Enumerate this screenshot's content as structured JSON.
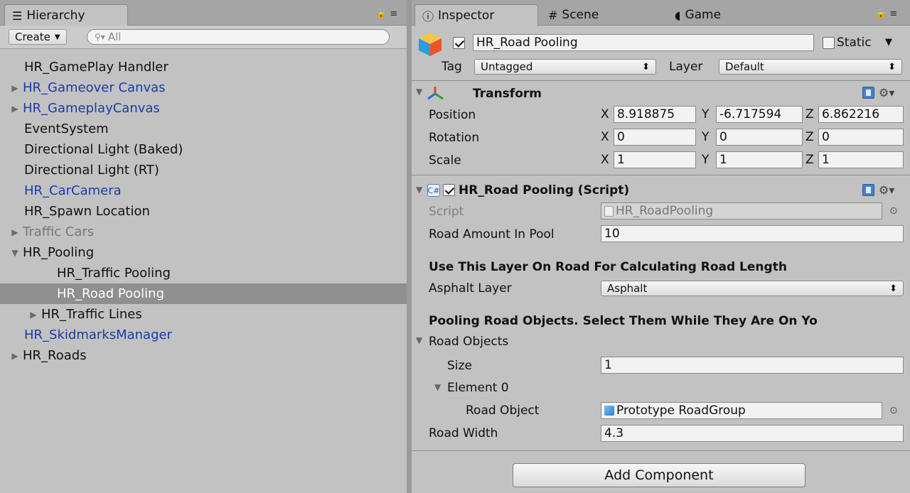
{
  "hierarchy": {
    "tab_label": "Hierarchy",
    "create_label": "Create",
    "search_placeholder": "All",
    "items": [
      {
        "label": "HR_GamePlay Handler",
        "style": "normal",
        "arrow": ""
      },
      {
        "label": "HR_Gameover Canvas",
        "style": "blue",
        "arrow": "▶"
      },
      {
        "label": "HR_GameplayCanvas",
        "style": "blue",
        "arrow": "▶"
      },
      {
        "label": "EventSystem",
        "style": "normal",
        "arrow": ""
      },
      {
        "label": "Directional Light (Baked)",
        "style": "normal",
        "arrow": ""
      },
      {
        "label": "Directional Light (RT)",
        "style": "normal",
        "arrow": ""
      },
      {
        "label": "HR_CarCamera",
        "style": "blue",
        "arrow": ""
      },
      {
        "label": "HR_Spawn Location",
        "style": "normal",
        "arrow": ""
      },
      {
        "label": "Traffic Cars",
        "style": "gray",
        "arrow": "▶"
      },
      {
        "label": "HR_Pooling",
        "style": "normal",
        "arrow": "▼"
      },
      {
        "label": "HR_Traffic Pooling",
        "style": "normal",
        "arrow": ""
      },
      {
        "label": "HR_Road Pooling",
        "style": "selected",
        "arrow": ""
      },
      {
        "label": "HR_Traffic Lines",
        "style": "normal",
        "arrow": "▶"
      },
      {
        "label": "HR_SkidmarksManager",
        "style": "blue",
        "arrow": ""
      },
      {
        "label": "HR_Roads",
        "style": "normal",
        "arrow": "▶"
      }
    ]
  },
  "tabs": {
    "inspector": "Inspector",
    "scene": "Scene",
    "game": "Game"
  },
  "inspector": {
    "object_name": "HR_Road Pooling",
    "static_label": "Static",
    "tag_label": "Tag",
    "tag_value": "Untagged",
    "layer_label": "Layer",
    "layer_value": "Default",
    "transform": {
      "title": "Transform",
      "position_label": "Position",
      "rotation_label": "Rotation",
      "scale_label": "Scale",
      "axis_x": "X",
      "axis_y": "Y",
      "axis_z": "Z",
      "position": [
        "8.918875",
        "-6.717594",
        "6.862216"
      ],
      "rotation": [
        "0",
        "0",
        "0"
      ],
      "scale": [
        "1",
        "1",
        "1"
      ]
    },
    "script": {
      "title": "HR_Road Pooling (Script)",
      "script_label": "Script",
      "script_value": "HR_RoadPooling",
      "road_amount_label": "Road Amount In Pool",
      "road_amount_value": "10",
      "header1": "Use This Layer On Road For Calculating Road Length",
      "asphalt_label": "Asphalt Layer",
      "asphalt_value": "Asphalt",
      "header2": "Pooling Road Objects. Select Them While They Are On Yo",
      "road_objects_label": "Road Objects",
      "size_label": "Size",
      "size_value": "1",
      "element_label": "Element 0",
      "road_object_label": "Road Object",
      "road_object_value": "Prototype RoadGroup",
      "road_width_label": "Road Width",
      "road_width_value": "4.3"
    },
    "add_component_label": "Add Component"
  }
}
